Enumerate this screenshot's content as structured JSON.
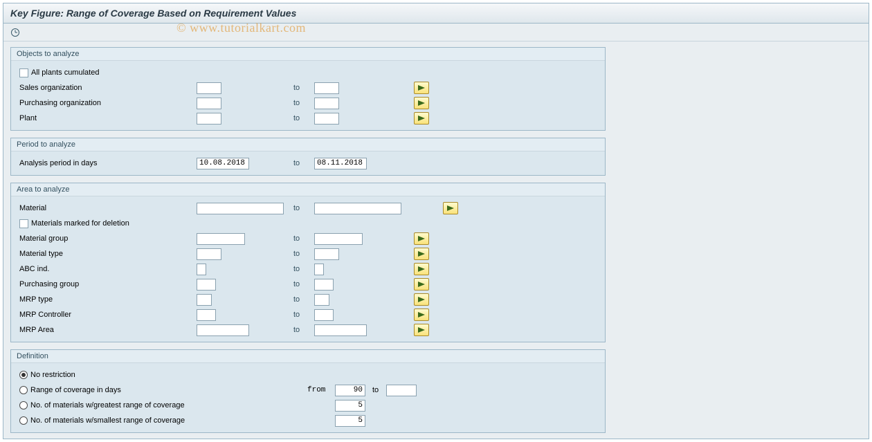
{
  "window_title": "Key Figure: Range of Coverage Based on Requirement Values",
  "watermark": "© www.tutorialkart.com",
  "toolbar": {
    "execute_name": "execute"
  },
  "to_label": "to",
  "from_label": "from",
  "groups": {
    "objects": {
      "title": "Objects to analyze",
      "all_plants": "All plants cumulated",
      "sales_org": "Sales organization",
      "purchasing_org": "Purchasing organization",
      "plant": "Plant"
    },
    "period": {
      "title": "Period to analyze",
      "label": "Analysis period in days",
      "from": "10.08.2018",
      "to": "08.11.2018"
    },
    "area": {
      "title": "Area to analyze",
      "material": "Material",
      "materials_del": "Materials marked for deletion",
      "material_group": "Material group",
      "material_type": "Material type",
      "abc": "ABC ind.",
      "purchasing_group": "Purchasing group",
      "mrp_type": "MRP type",
      "mrp_controller": "MRP Controller",
      "mrp_area": "MRP Area"
    },
    "definition": {
      "title": "Definition",
      "no_restriction": "No restriction",
      "range_days": "Range of coverage in days",
      "range_from": "90",
      "greatest": "No. of materials w/greatest range of coverage",
      "greatest_val": "5",
      "smallest": "No. of materials w/smallest range of coverage",
      "smallest_val": "5"
    }
  }
}
